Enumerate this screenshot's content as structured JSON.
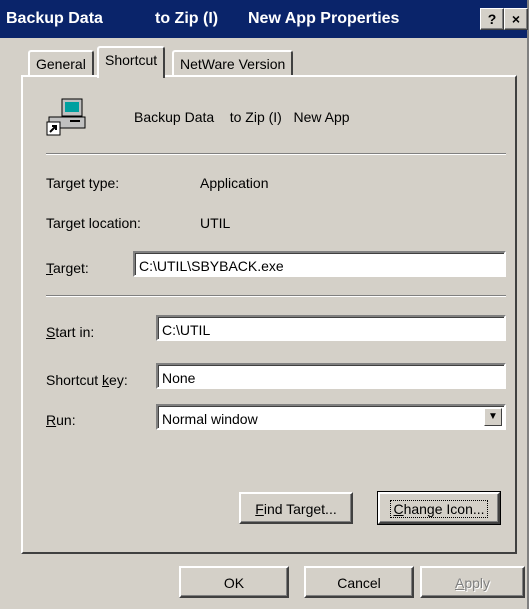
{
  "window": {
    "title_parts": [
      "Backup Data",
      "to Zip (I)",
      "New App Properties"
    ],
    "help_glyph": "?",
    "close_glyph": "×"
  },
  "tabs": [
    {
      "label": "General",
      "active": false
    },
    {
      "label": "Shortcut",
      "active": true
    },
    {
      "label": "NetWare Version",
      "active": false
    }
  ],
  "shortcut": {
    "icon": "shortcut-computer-icon",
    "name": "Backup Data    to Zip (I)   New App",
    "target_type": {
      "label": "Target type:",
      "value": "Application"
    },
    "target_location": {
      "label": "Target location:",
      "value": "UTIL"
    },
    "target": {
      "label_accel": "T",
      "label_rest": "arget:",
      "value": "C:\\UTIL\\SBYBACK.exe"
    },
    "start_in": {
      "label_accel": "S",
      "label_rest": "tart in:",
      "value": "C:\\UTIL"
    },
    "shortcut_key": {
      "label_pre": "Shortcut ",
      "label_accel": "k",
      "label_rest": "ey:",
      "value": "None"
    },
    "run": {
      "label_accel": "R",
      "label_rest": "un:",
      "value": "Normal window",
      "arrow": "▼"
    },
    "find_target": {
      "accel": "F",
      "rest": "ind Target..."
    },
    "change_icon": {
      "accel": "C",
      "rest": "hange Icon..."
    }
  },
  "footer": {
    "ok": "OK",
    "cancel": "Cancel",
    "apply_accel": "A",
    "apply_rest": "pply"
  },
  "colors": {
    "titlebar": "#0a246a",
    "face": "#d4d0c8",
    "shadow": "#808080",
    "highlight": "#ffffff"
  }
}
